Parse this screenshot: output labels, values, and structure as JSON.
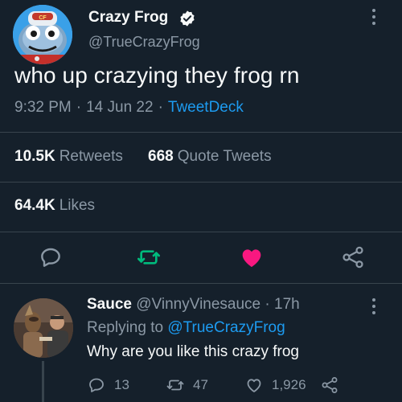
{
  "tweet": {
    "author_name": "Crazy Frog",
    "author_handle": "@TrueCrazyFrog",
    "text": "who up crazying they frog rn",
    "time": "9:32 PM",
    "date": "14 Jun 22",
    "source": "TweetDeck",
    "separator": "·",
    "stats": {
      "retweets_count": "10.5K",
      "retweets_label": "Retweets",
      "quotes_count": "668",
      "quotes_label": "Quote Tweets",
      "likes_count": "64.4K",
      "likes_label": "Likes"
    },
    "actions": {
      "reply_icon": "reply-icon",
      "retweet_icon": "retweet-icon",
      "like_icon": "heart-icon",
      "share_icon": "share-icon"
    },
    "colors": {
      "retweet_active": "#00ba7c",
      "like_active": "#f91880",
      "accent": "#1d9bf0",
      "background": "#15202b"
    }
  },
  "reply": {
    "name": "Sauce",
    "handle": "@VinnyVinesauce",
    "separator": "·",
    "time": "17h",
    "replying_prefix": "Replying to",
    "replying_mention": "@TrueCrazyFrog",
    "text": "Why are you like this crazy frog",
    "replies_count": "13",
    "retweets_count": "47",
    "likes_count": "1,926"
  }
}
